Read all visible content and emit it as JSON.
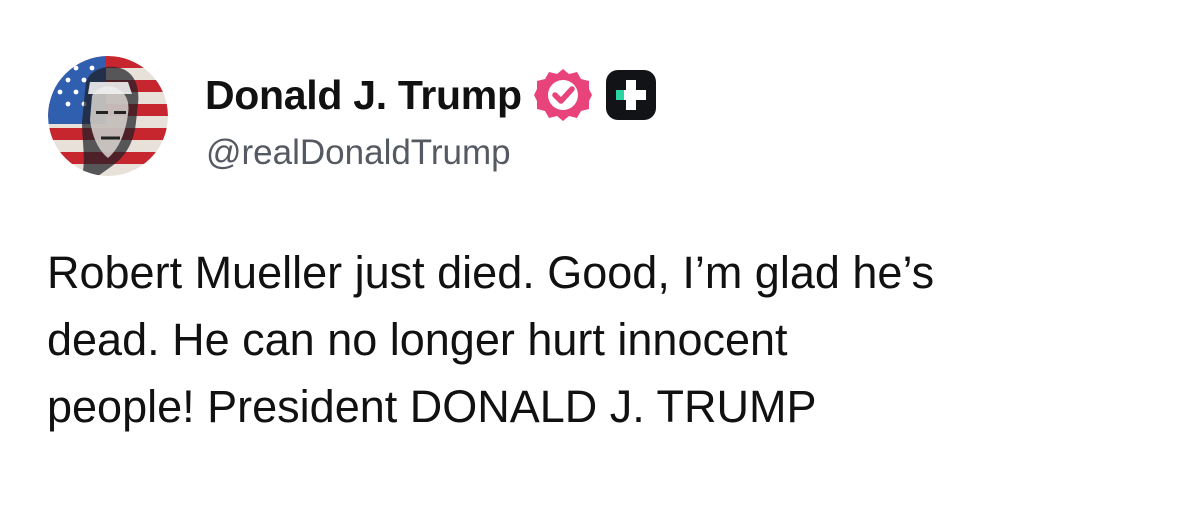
{
  "author": {
    "display_name": "Donald J. Trump",
    "handle": "@realDonaldTrump",
    "avatar_icon": "flag-portrait-avatar",
    "verified_icon": "verified-badge-icon",
    "plus_icon": "plus-badge-icon"
  },
  "post": {
    "text": "Robert Mueller just died. Good, I’m glad he’s\ndead. He can no longer hurt innocent\npeople! President DONALD J. TRUMP"
  },
  "colors": {
    "verified_badge": "#e8437a",
    "plus_badge_bg": "#121316",
    "plus_badge_accent": "#2ed3a3",
    "handle_text": "#555a62"
  }
}
